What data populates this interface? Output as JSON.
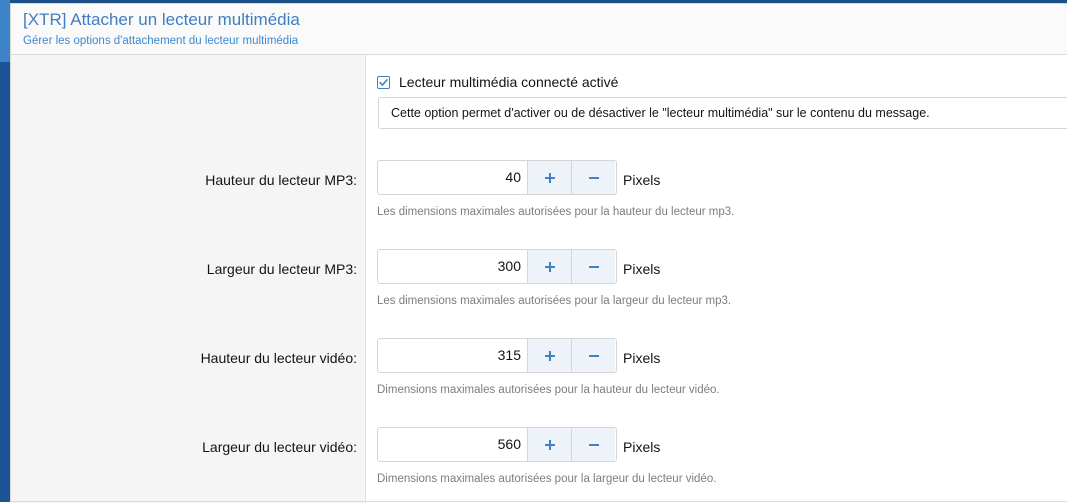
{
  "header": {
    "title": "[XTR] Attacher un lecteur multimédia",
    "subtitle": "Gérer les options d'attachement du lecteur multimédia"
  },
  "enable_option": {
    "checked": true,
    "label": "Lecteur multimédia connecté activé",
    "explain": "Cette option permet d'activer ou de désactiver le \"lecteur multimédia\" sur le contenu du message."
  },
  "fields": [
    {
      "label": "Hauteur du lecteur MP3:",
      "value": "40",
      "units": "Pixels",
      "hint": "Les dimensions maximales autorisées pour la hauteur du lecteur mp3."
    },
    {
      "label": "Largeur du lecteur MP3:",
      "value": "300",
      "units": "Pixels",
      "hint": "Les dimensions maximales autorisées pour la largeur du lecteur mp3."
    },
    {
      "label": "Hauteur du lecteur vidéo:",
      "value": "315",
      "units": "Pixels",
      "hint": "Dimensions maximales autorisées pour la hauteur du lecteur vidéo."
    },
    {
      "label": "Largeur du lecteur vidéo:",
      "value": "560",
      "units": "Pixels",
      "hint": "Dimensions maximales autorisées pour la largeur du lecteur vidéo."
    }
  ],
  "icons": {
    "increment": "plus-icon",
    "decrement": "minus-icon",
    "checkbox": "check-icon"
  },
  "colors": {
    "accent": "#3c83c7",
    "title": "#3f7ec0",
    "hint": "#7d7d7d"
  }
}
